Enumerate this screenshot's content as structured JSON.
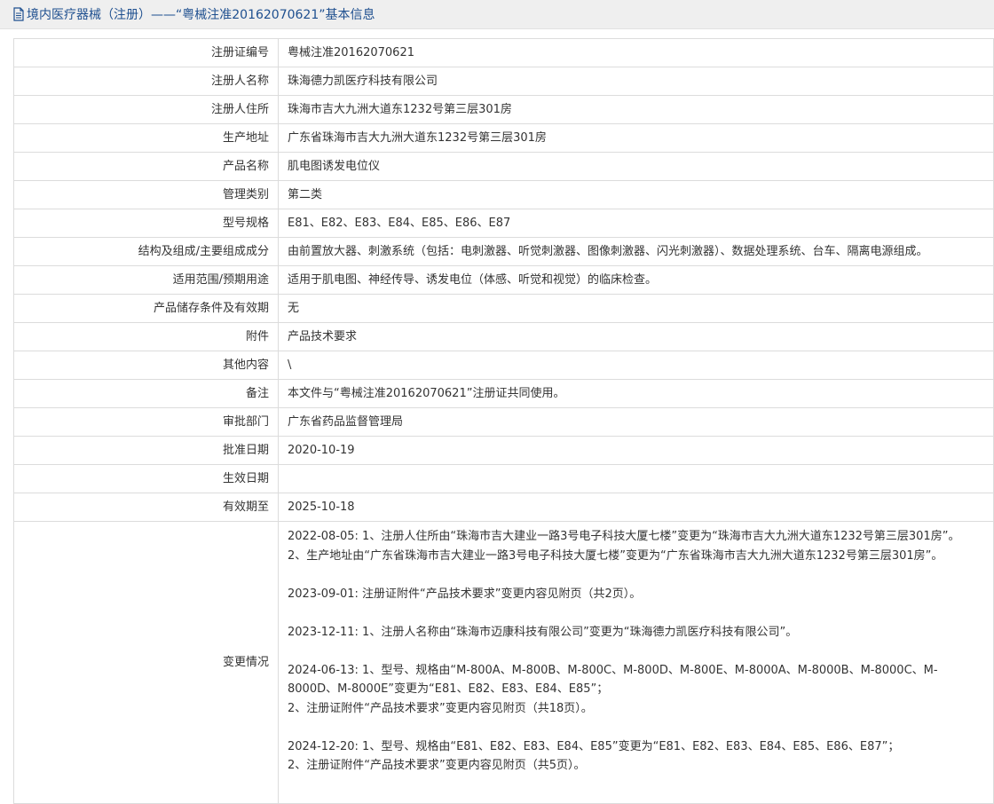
{
  "header": {
    "title": "境内医疗器械（注册）——“粤械注准20162070621”基本信息",
    "icon": "document-icon",
    "accent_color": "#1e4f8f"
  },
  "rows": [
    {
      "label": "注册证编号",
      "value": "粤械注准20162070621"
    },
    {
      "label": "注册人名称",
      "value": "珠海德力凯医疗科技有限公司"
    },
    {
      "label": "注册人住所",
      "value": "珠海市吉大九洲大道东1232号第三层301房"
    },
    {
      "label": "生产地址",
      "value": "广东省珠海市吉大九洲大道东1232号第三层301房"
    },
    {
      "label": "产品名称",
      "value": "肌电图诱发电位仪"
    },
    {
      "label": "管理类别",
      "value": "第二类"
    },
    {
      "label": "型号规格",
      "value": "E81、E82、E83、E84、E85、E86、E87"
    },
    {
      "label": "结构及组成/主要组成成分",
      "value": "由前置放大器、刺激系统（包括：电刺激器、听觉刺激器、图像刺激器、闪光刺激器）、数据处理系统、台车、隔离电源组成。"
    },
    {
      "label": "适用范围/预期用途",
      "value": "适用于肌电图、神经传导、诱发电位（体感、听觉和视觉）的临床检查。"
    },
    {
      "label": "产品储存条件及有效期",
      "value": "无"
    },
    {
      "label": "附件",
      "value": "产品技术要求"
    },
    {
      "label": "其他内容",
      "value": "\\"
    },
    {
      "label": "备注",
      "value": "本文件与“粤械注准20162070621”注册证共同使用。"
    },
    {
      "label": "审批部门",
      "value": "广东省药品监督管理局"
    },
    {
      "label": "批准日期",
      "value": "2020-10-19"
    },
    {
      "label": "生效日期",
      "value": ""
    },
    {
      "label": "有效期至",
      "value": "2025-10-18"
    }
  ],
  "changes": {
    "label": "变更情况",
    "entries": [
      {
        "lines": [
          "2022-08-05: 1、注册人住所由“珠海市吉大建业一路3号电子科技大厦七楼”变更为“珠海市吉大九洲大道东1232号第三层301房”。",
          "2、生产地址由“广东省珠海市吉大建业一路3号电子科技大厦七楼”变更为“广东省珠海市吉大九洲大道东1232号第三层301房”。"
        ]
      },
      {
        "lines": [
          "2023-09-01: 注册证附件“产品技术要求”变更内容见附页（共2页）。"
        ]
      },
      {
        "lines": [
          "2023-12-11: 1、注册人名称由“珠海市迈康科技有限公司”变更为“珠海德力凯医疗科技有限公司”。"
        ]
      },
      {
        "lines": [
          "2024-06-13: 1、型号、规格由“M-800A、M-800B、M-800C、M-800D、M-800E、M-8000A、M-8000B、M-8000C、M-8000D、M-8000E”变更为“E81、E82、E83、E84、E85”；",
          "2、注册证附件“产品技术要求”变更内容见附页（共18页）。"
        ]
      },
      {
        "lines": [
          "2024-12-20: 1、型号、规格由“E81、E82、E83、E84、E85”变更为“E81、E82、E83、E84、E85、E86、E87”；",
          "2、注册证附件“产品技术要求”变更内容见附页（共5页）。"
        ]
      }
    ]
  }
}
